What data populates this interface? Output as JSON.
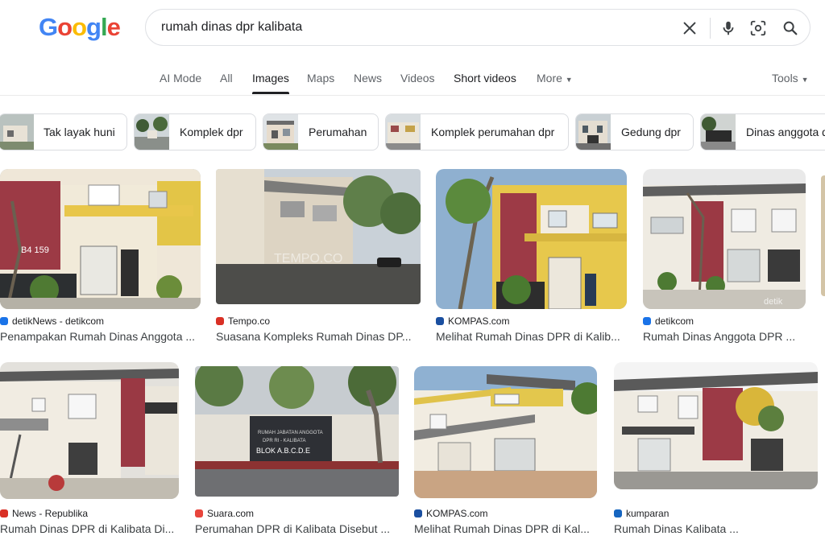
{
  "logo": {
    "letters": [
      "G",
      "o",
      "o",
      "g",
      "l",
      "e"
    ],
    "colors": [
      "#4285F4",
      "#EA4335",
      "#FBBC05",
      "#4285F4",
      "#34A853",
      "#EA4335"
    ]
  },
  "search": {
    "query": "rumah dinas dpr kalibata"
  },
  "tabs": [
    {
      "label": "AI Mode"
    },
    {
      "label": "All"
    },
    {
      "label": "Images"
    },
    {
      "label": "Maps"
    },
    {
      "label": "News"
    },
    {
      "label": "Videos"
    },
    {
      "label": "Short videos"
    },
    {
      "label": "More"
    }
  ],
  "tools_label": "Tools",
  "chips": [
    {
      "label": "Tak layak huni"
    },
    {
      "label": "Komplek dpr"
    },
    {
      "label": "Perumahan"
    },
    {
      "label": "Komplek perumahan dpr"
    },
    {
      "label": "Gedung dpr"
    },
    {
      "label": "Dinas anggota d"
    }
  ],
  "results": [
    {
      "source": "detikNews - detikcom",
      "title": "Penampakan Rumah Dinas Anggota ...",
      "favicon_color": "#1a73e8",
      "watermark": "",
      "plate": "B4 159"
    },
    {
      "source": "Tempo.co",
      "title": "Suasana Kompleks Rumah Dinas DP...",
      "favicon_color": "#d93025",
      "watermark": "TEMPO.CO",
      "plate": ""
    },
    {
      "source": "KOMPAS.com",
      "title": "Melihat Rumah Dinas DPR di Kalib...",
      "favicon_color": "#1a4fa0",
      "watermark": "",
      "plate": ""
    },
    {
      "source": "detikcom",
      "title": "Rumah Dinas Anggota DPR ...",
      "favicon_color": "#1a73e8",
      "watermark": "detik",
      "plate": ""
    },
    {
      "source": "News - Republika",
      "title": "Rumah Dinas DPR di Kalibata Di...",
      "favicon_color": "#d93025",
      "watermark": "",
      "plate": ""
    },
    {
      "source": "Suara.com",
      "title": "Perumahan DPR di Kalibata Disebut ...",
      "favicon_color": "#e8453c",
      "watermark": "",
      "plate": "",
      "sign_lines": [
        "RUMAH JABATAN ANGGOTA",
        "DPR RI - KALIBATA",
        "BLOK A.B.C.D.E"
      ]
    },
    {
      "source": "KOMPAS.com",
      "title": "Melihat Rumah Dinas DPR di Kal...",
      "favicon_color": "#1a4fa0",
      "watermark": "",
      "plate": ""
    },
    {
      "source": "kumparan",
      "title": "Rumah Dinas Kalibata ...",
      "favicon_color": "#1565c0",
      "watermark": "",
      "plate": ""
    }
  ]
}
